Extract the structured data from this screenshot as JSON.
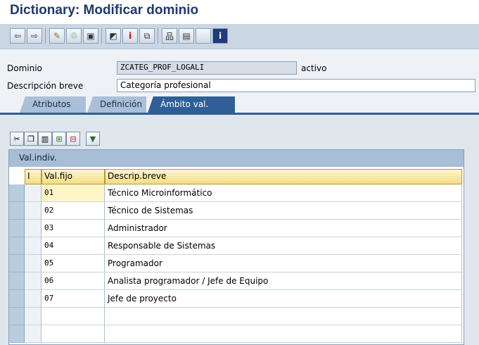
{
  "window": {
    "title": "Dictionary: Modificar dominio"
  },
  "toolbar": {
    "icons": [
      "back-arrow-icon",
      "forward-arrow-icon",
      "display-change-icon",
      "activate-icon",
      "object-list-icon",
      "other-object-icon",
      "info-icon",
      "hierarchy-icon",
      "where-used-icon",
      "print-icon",
      "blank-icon",
      "help-info-icon"
    ]
  },
  "fields": {
    "dominio_label": "Dominio",
    "dominio_value": "ZCATEG_PROF_LOGALI",
    "status": "activo",
    "descripcion_label": "Descripción breve",
    "descripcion_value": "Categoría profesional"
  },
  "tabs": [
    {
      "label": "Atributos",
      "active": false
    },
    {
      "label": "Definición",
      "active": false
    },
    {
      "label": "Ámbito val.",
      "active": true
    }
  ],
  "table": {
    "title": "Val.indiv.",
    "columns": [
      "I",
      "Val.fijo",
      "Descrip.breve"
    ],
    "rows": [
      {
        "val": "01",
        "desc": "Técnico Microinformático"
      },
      {
        "val": "02",
        "desc": "Técnico de Sistemas"
      },
      {
        "val": "03",
        "desc": "Administrador"
      },
      {
        "val": "04",
        "desc": "Responsable de Sistemas"
      },
      {
        "val": "05",
        "desc": "Programador"
      },
      {
        "val": "06",
        "desc": "Analista programador / Jefe de Equipo"
      },
      {
        "val": "07",
        "desc": "Jefe de proyecto"
      },
      {
        "val": "",
        "desc": ""
      },
      {
        "val": "",
        "desc": ""
      }
    ]
  }
}
